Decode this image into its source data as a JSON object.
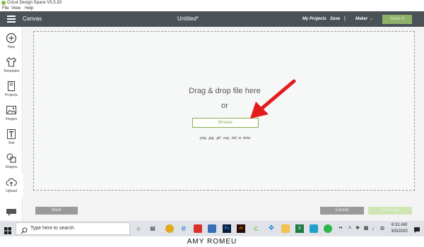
{
  "window": {
    "title": "Cricut Design Space  V5.5.33"
  },
  "menu": {
    "items": [
      "File",
      "View",
      "Help"
    ]
  },
  "header": {
    "canvas_label": "Canvas",
    "doc_title": "Untitled*",
    "my_projects": "My Projects",
    "save": "Save",
    "separator": "|",
    "maker": "Maker",
    "make_it": "Make It"
  },
  "sidebar": {
    "items": [
      {
        "label": "New",
        "icon": "plus-circle-icon"
      },
      {
        "label": "Templates",
        "icon": "shirt-icon"
      },
      {
        "label": "Projects",
        "icon": "book-icon"
      },
      {
        "label": "Images",
        "icon": "image-icon"
      },
      {
        "label": "Text",
        "icon": "text-icon"
      },
      {
        "label": "Shapes",
        "icon": "shapes-icon"
      },
      {
        "label": "Upload",
        "icon": "cloud-upload-icon"
      }
    ]
  },
  "upload": {
    "drag_text": "Drag & drop file here",
    "or_text": "or",
    "browse_label": "Browse",
    "formats": ".png, .jpg, .gif, .svg, .dxf, or .bmp",
    "back_label": "Back",
    "cancel_label": "Cancel",
    "continue_label": "Continue"
  },
  "taskbar": {
    "search_placeholder": "Type here to search",
    "time": "6:31 AM",
    "date": "3/5/2020"
  },
  "caption": "AMY ROMEU",
  "colors": {
    "header_bg": "#4a5257",
    "accent_green": "#8bb04c",
    "arrow_red": "#e31b1b"
  }
}
